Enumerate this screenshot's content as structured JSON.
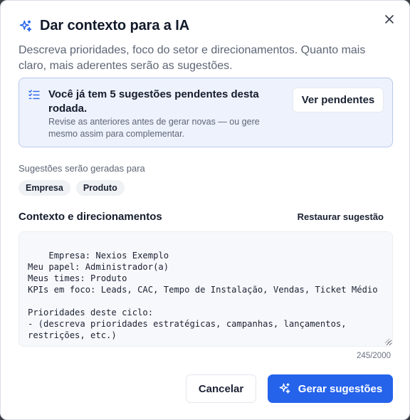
{
  "dialog": {
    "title": "Dar contexto para a IA",
    "description": "Descreva prioridades, foco do setor e direcionamentos. Quanto mais claro, mais aderentes serão as sugestões.",
    "close_icon": "close-icon",
    "title_icon": "sparkles-icon"
  },
  "notice": {
    "icon": "checklist-icon",
    "title": "Você já tem 5 sugestões pendentes desta rodada.",
    "subtitle": "Revise as anteriores antes de gerar novas — ou gere mesmo assim para complementar.",
    "button_label": "Ver pendentes"
  },
  "targets": {
    "label": "Sugestões serão geradas para",
    "chips": [
      "Empresa",
      "Produto"
    ]
  },
  "context": {
    "title": "Contexto e direcionamentos",
    "restore_label": "Restaurar sugestão",
    "text": "Empresa: Nexios Exemplo\nMeu papel: Administrador(a)\nMeus times: Produto\nKPIs em foco: Leads, CAC, Tempo de Instalação, Vendas, Ticket Médio\n\nPrioridades deste ciclo:\n- (descreva prioridades estratégicas, campanhas, lançamentos, restrições, etc.)",
    "counter": "245/2000"
  },
  "footer": {
    "cancel_label": "Cancelar",
    "submit_label": "Gerar sugestões",
    "submit_icon": "sparkles-icon"
  },
  "colors": {
    "primary": "#2563eb",
    "notice_bg": "#eef2fc",
    "notice_border": "#b8c8ef"
  }
}
